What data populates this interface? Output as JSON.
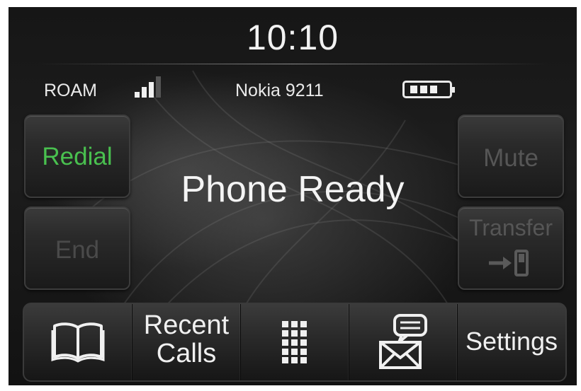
{
  "clock": "10:10",
  "status_bar": {
    "network": "ROAM",
    "signal_bars": 3,
    "signal_max": 4,
    "phone_name": "Nokia 9211",
    "battery_level_fraction": 0.75
  },
  "status_message": "Phone Ready",
  "side_buttons": {
    "redial": {
      "label": "Redial",
      "color": "#49c04f"
    },
    "end": {
      "label": "End"
    },
    "mute": {
      "label": "Mute"
    },
    "transfer": {
      "label": "Transfer",
      "icon": "transfer-to-phone-icon"
    }
  },
  "tab_bar": {
    "phonebook": {
      "icon": "phonebook-icon"
    },
    "recent_calls": {
      "line1": "Recent",
      "line2": "Calls"
    },
    "keypad": {
      "icon": "keypad-icon"
    },
    "messaging": {
      "icon": "messaging-icon"
    },
    "settings": {
      "label": "Settings"
    }
  }
}
